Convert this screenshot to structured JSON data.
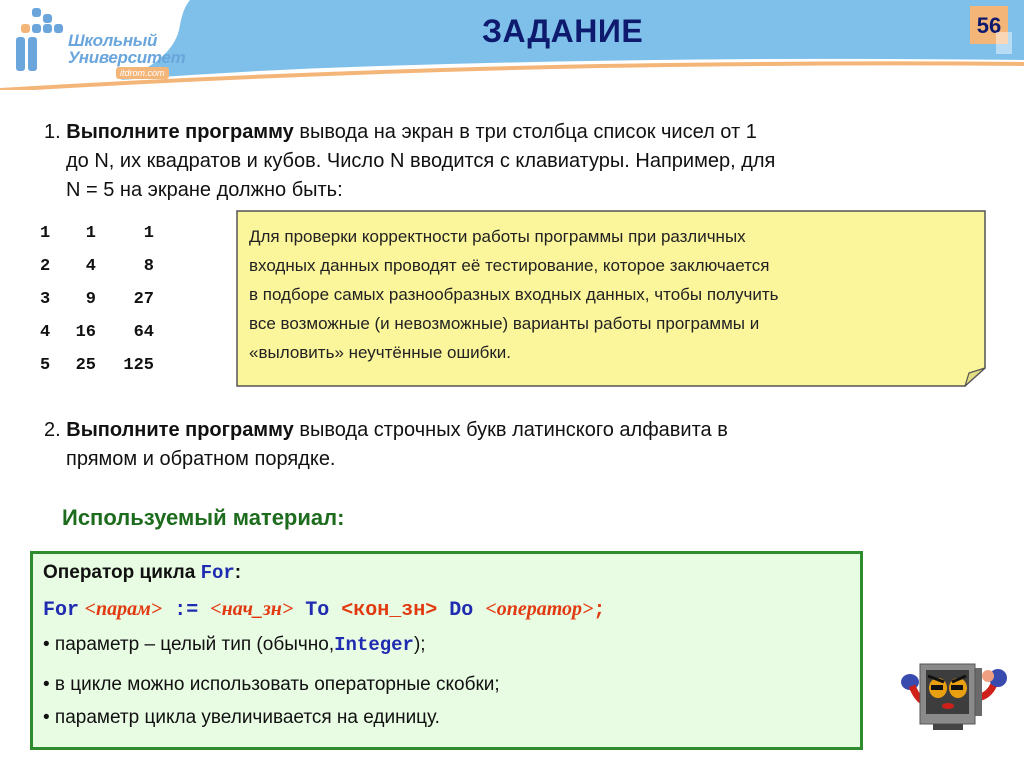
{
  "header": {
    "logo": {
      "line1": "Школьный",
      "line2": "Университет",
      "url": "itdrom.com"
    },
    "title": "ЗАДАНИЕ",
    "page_number": "56"
  },
  "task1": {
    "number": "1.",
    "bold": "Выполните программу",
    "line1_rest": " вывода на экран  в три столбца  список чисел от   1",
    "line2": "до N, их квадратов  и кубов. Число  N  вводится с клавиатуры. Например, для",
    "line3": "N = 5  на экране должно быть:"
  },
  "example_output": {
    "rows": [
      [
        "1",
        "1",
        "1"
      ],
      [
        "2",
        "4",
        "8"
      ],
      [
        "3",
        "9",
        "27"
      ],
      [
        "4",
        "16",
        "64"
      ],
      [
        "5",
        "25",
        "125"
      ]
    ]
  },
  "note": {
    "lines": [
      "Для проверки корректности работы программы при различных",
      "входных данных проводят её тестирование, которое заключается",
      "в  подборе самых разнообразных входных данных, чтобы получить",
      "все возможные (и невозможные) варианты работы программы и",
      "«выловить» неучтённые ошибки."
    ]
  },
  "task2": {
    "number": "2.",
    "bold": "Выполните программу",
    "line1_rest": " вывода  строчных букв латинского алфавита в",
    "line2": "прямом и обратном порядке."
  },
  "material": {
    "title": "Используемый материал:",
    "heading_text": "Оператор цикла ",
    "heading_kw": "For",
    "heading_colon": ":",
    "syntax": {
      "for": "For",
      "param": "<парам>",
      "assign": " := ",
      "start": "<нач_зн>",
      "to": " To ",
      "end": "<кон_зн>",
      "do": " Do ",
      "op": "<оператор>",
      "semi": ";"
    },
    "bullet1_pre": "• параметр – целый тип (обычно,",
    "bullet1_kw": "Integer",
    "bullet1_post": ");",
    "bullet2": "• в цикле можно использовать операторные скобки;",
    "bullet3": "• параметр цикла увеличивается на единицу."
  },
  "colors": {
    "header_blue": "#7fc0ea",
    "header_orange": "#f4b579",
    "title_navy": "#0d1a6e",
    "note_yellow": "#fbf59c",
    "box_green_bg": "#e8fbe3",
    "box_green_border": "#2e8b2e",
    "keyword_blue": "#1f2bb0",
    "placeholder_red": "#e23a10"
  }
}
